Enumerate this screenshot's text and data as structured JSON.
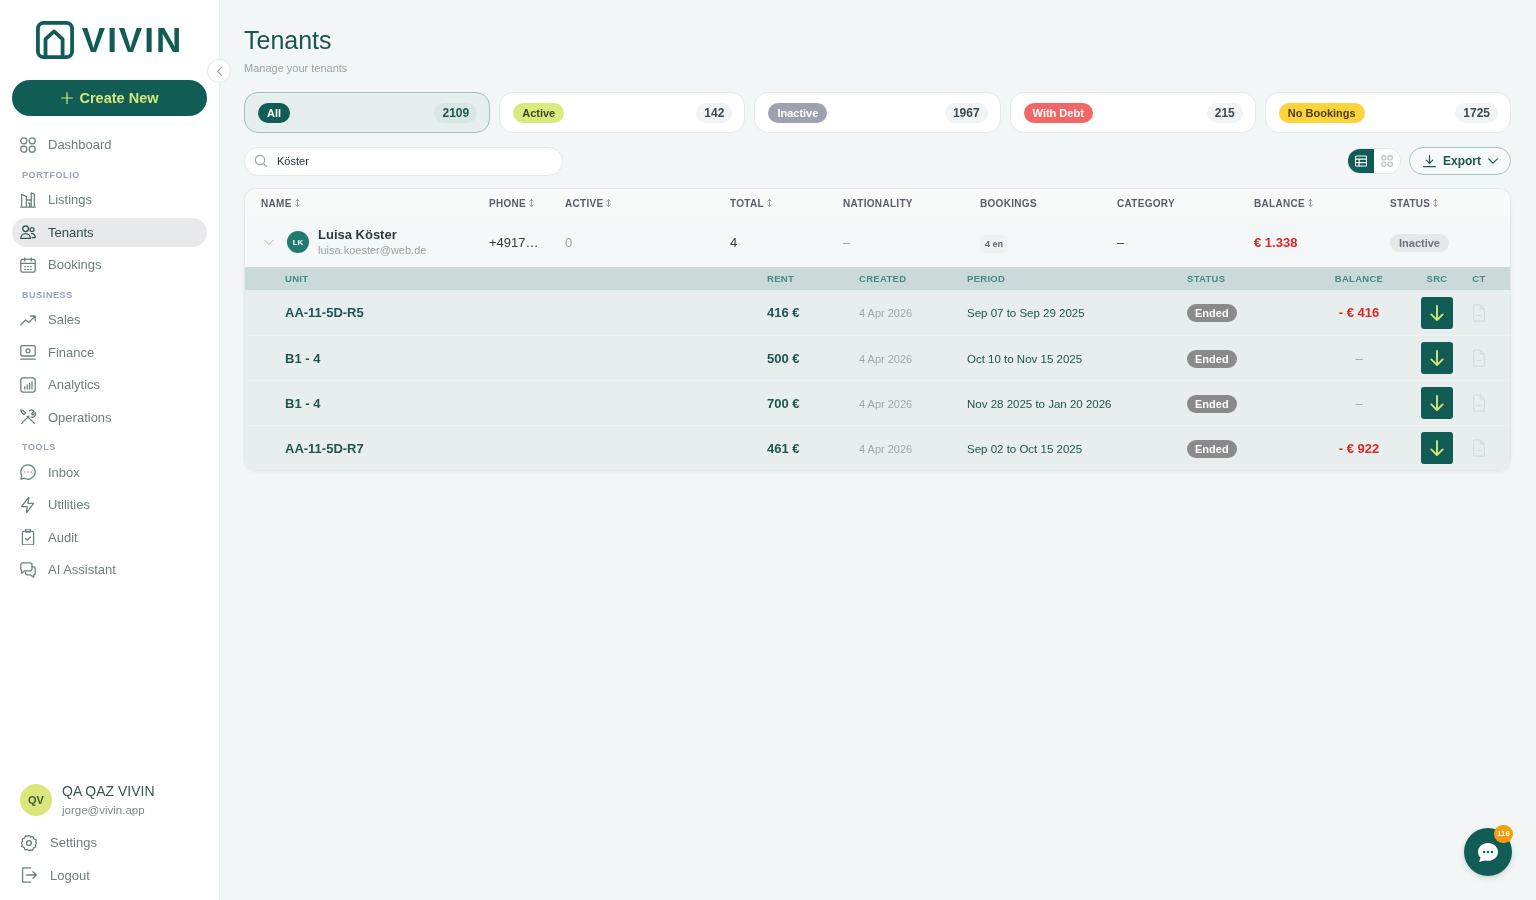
{
  "sidebar": {
    "logo": "VIVIN",
    "create_button": "Create New",
    "nav": [
      {
        "kind": "item",
        "label": "Dashboard",
        "selected": false
      },
      {
        "kind": "section",
        "label": "PORTFOLIO"
      },
      {
        "kind": "item",
        "label": "Listings",
        "selected": false
      },
      {
        "kind": "item",
        "label": "Tenants",
        "selected": true
      },
      {
        "kind": "item",
        "label": "Bookings",
        "selected": false
      },
      {
        "kind": "section",
        "label": "BUSINESS"
      },
      {
        "kind": "item",
        "label": "Sales",
        "selected": false
      },
      {
        "kind": "item",
        "label": "Finance",
        "selected": false
      },
      {
        "kind": "item",
        "label": "Analytics",
        "selected": false
      },
      {
        "kind": "item",
        "label": "Operations",
        "selected": false
      },
      {
        "kind": "section",
        "label": "TOOLS"
      },
      {
        "kind": "item",
        "label": "Inbox",
        "selected": false
      },
      {
        "kind": "item",
        "label": "Utilities",
        "selected": false
      },
      {
        "kind": "item",
        "label": "Audit",
        "selected": false
      },
      {
        "kind": "item",
        "label": "AI Assistant",
        "selected": false
      }
    ],
    "user": {
      "initials": "QV",
      "name": "QA QAZ VIVIN",
      "email": "jorge@vivin.app"
    },
    "footer": [
      {
        "label": "Settings"
      },
      {
        "label": "Logout"
      }
    ]
  },
  "header": {
    "title": "Tenants",
    "subtitle": "Manage your tenants"
  },
  "filters": [
    {
      "label": "All",
      "count": "2109",
      "selected": true,
      "color": "#115c55"
    },
    {
      "label": "Active",
      "count": "142",
      "selected": false,
      "color": "#d9ea7f"
    },
    {
      "label": "Inactive",
      "count": "1967",
      "selected": false,
      "color": "#9ca3af"
    },
    {
      "label": "With Debt",
      "count": "215",
      "selected": false,
      "color": "#f26666"
    },
    {
      "label": "No Bookings",
      "count": "1725",
      "selected": false,
      "color": "#fcd33b"
    }
  ],
  "search": {
    "value": "Köster"
  },
  "view_modes": [
    {
      "selected": true
    },
    {
      "selected": false
    }
  ],
  "export_button": "Export",
  "table": {
    "columns": [
      {
        "label": "NAME",
        "sortable": true
      },
      {
        "label": "PHONE",
        "sortable": true
      },
      {
        "label": "ACTIVE",
        "sortable": true
      },
      {
        "label": "TOTAL",
        "sortable": true
      },
      {
        "label": "NATIONALITY",
        "sortable": false
      },
      {
        "label": "BOOKINGS",
        "sortable": false
      },
      {
        "label": "CATEGORY",
        "sortable": false
      },
      {
        "label": "BALANCE",
        "sortable": true
      },
      {
        "label": "STATUS",
        "sortable": true
      }
    ],
    "rows": [
      {
        "initials": "LK",
        "name": "Luisa Köster",
        "email": "luisa.koester@web.de",
        "phone": "+4917…",
        "active": "0",
        "total": "4",
        "nationality": "–",
        "bookings": "4 en",
        "category": "–",
        "balance": "€ 1.338",
        "in_debt": true,
        "status": "Inactive",
        "expanded": true,
        "detail_columns": [
          "UNIT",
          "RENT",
          "CREATED",
          "PERIOD",
          "STATUS",
          "BALANCE",
          "SRC",
          "CT"
        ],
        "details": [
          {
            "unit": "AA-11-5D-R5",
            "rent": "416 €",
            "created": "4 Apr 2026",
            "period": "Sep 07 to Sep 29 2025",
            "status": "Ended",
            "balance": "- € 416",
            "in_debt": true
          },
          {
            "unit": "B1 - 4",
            "rent": "500 €",
            "created": "4 Apr 2026",
            "period": "Oct 10 to Nov 15 2025",
            "status": "Ended",
            "balance": "–",
            "in_debt": false
          },
          {
            "unit": "B1 - 4",
            "rent": "700 €",
            "created": "4 Apr 2026",
            "period": "Nov 28 2025 to Jan 20 2026",
            "status": "Ended",
            "balance": "–",
            "in_debt": false
          },
          {
            "unit": "AA-11-5D-R7",
            "rent": "461 €",
            "created": "4 Apr 2026",
            "period": "Sep 02 to Oct 15 2025",
            "status": "Ended",
            "balance": "- € 922",
            "in_debt": true
          }
        ]
      }
    ]
  },
  "chat": {
    "badge": "116"
  }
}
